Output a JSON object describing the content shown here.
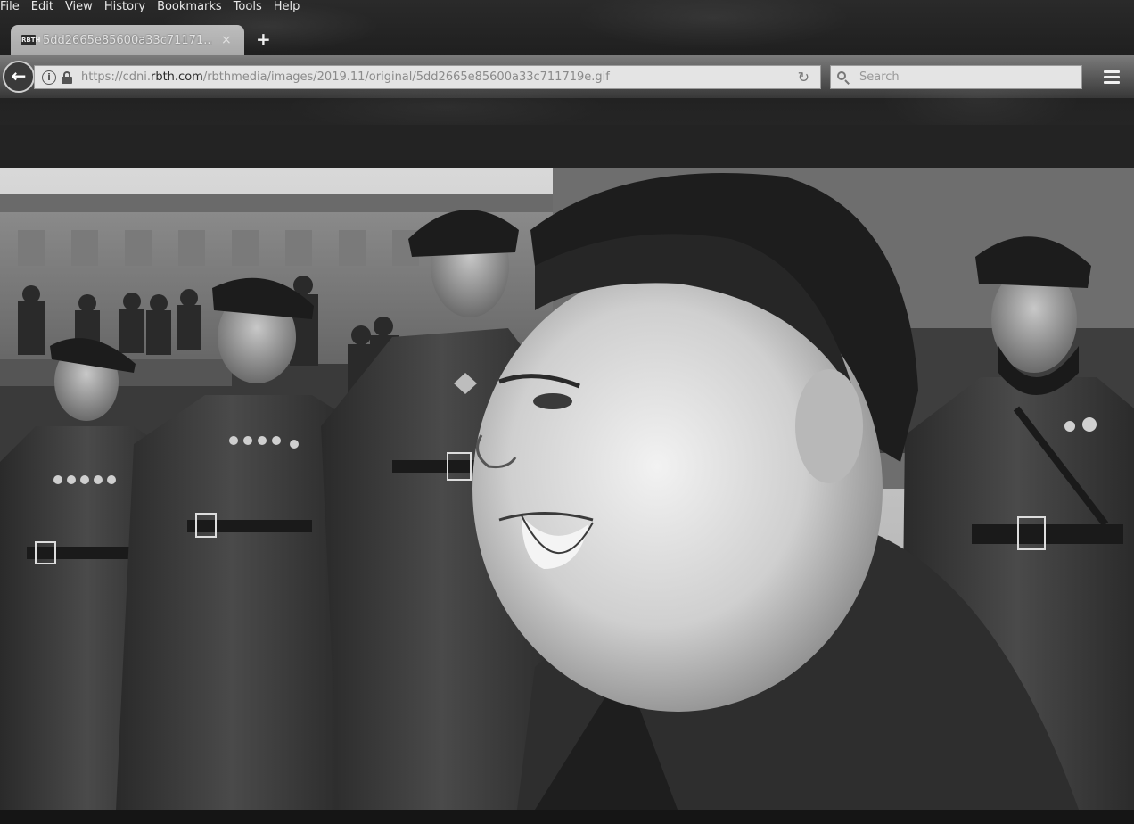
{
  "menu": [
    "File",
    "Edit",
    "View",
    "History",
    "Bookmarks",
    "Tools",
    "Help"
  ],
  "tab": {
    "favicon": "RBTH",
    "title": "5dd2665e85600a33c71171...",
    "close": "×"
  },
  "new_tab": "+",
  "nav": {
    "back": "←",
    "url_prefix": "https://cdni.",
    "url_domain": "rbth.com",
    "url_suffix": "/rbthmedia/images/2019.11/original/5dd2665e85600a33c711719e.gif",
    "reload": "↻",
    "search_placeholder": "Search"
  },
  "image": {
    "description_icon": "photo-collage"
  }
}
